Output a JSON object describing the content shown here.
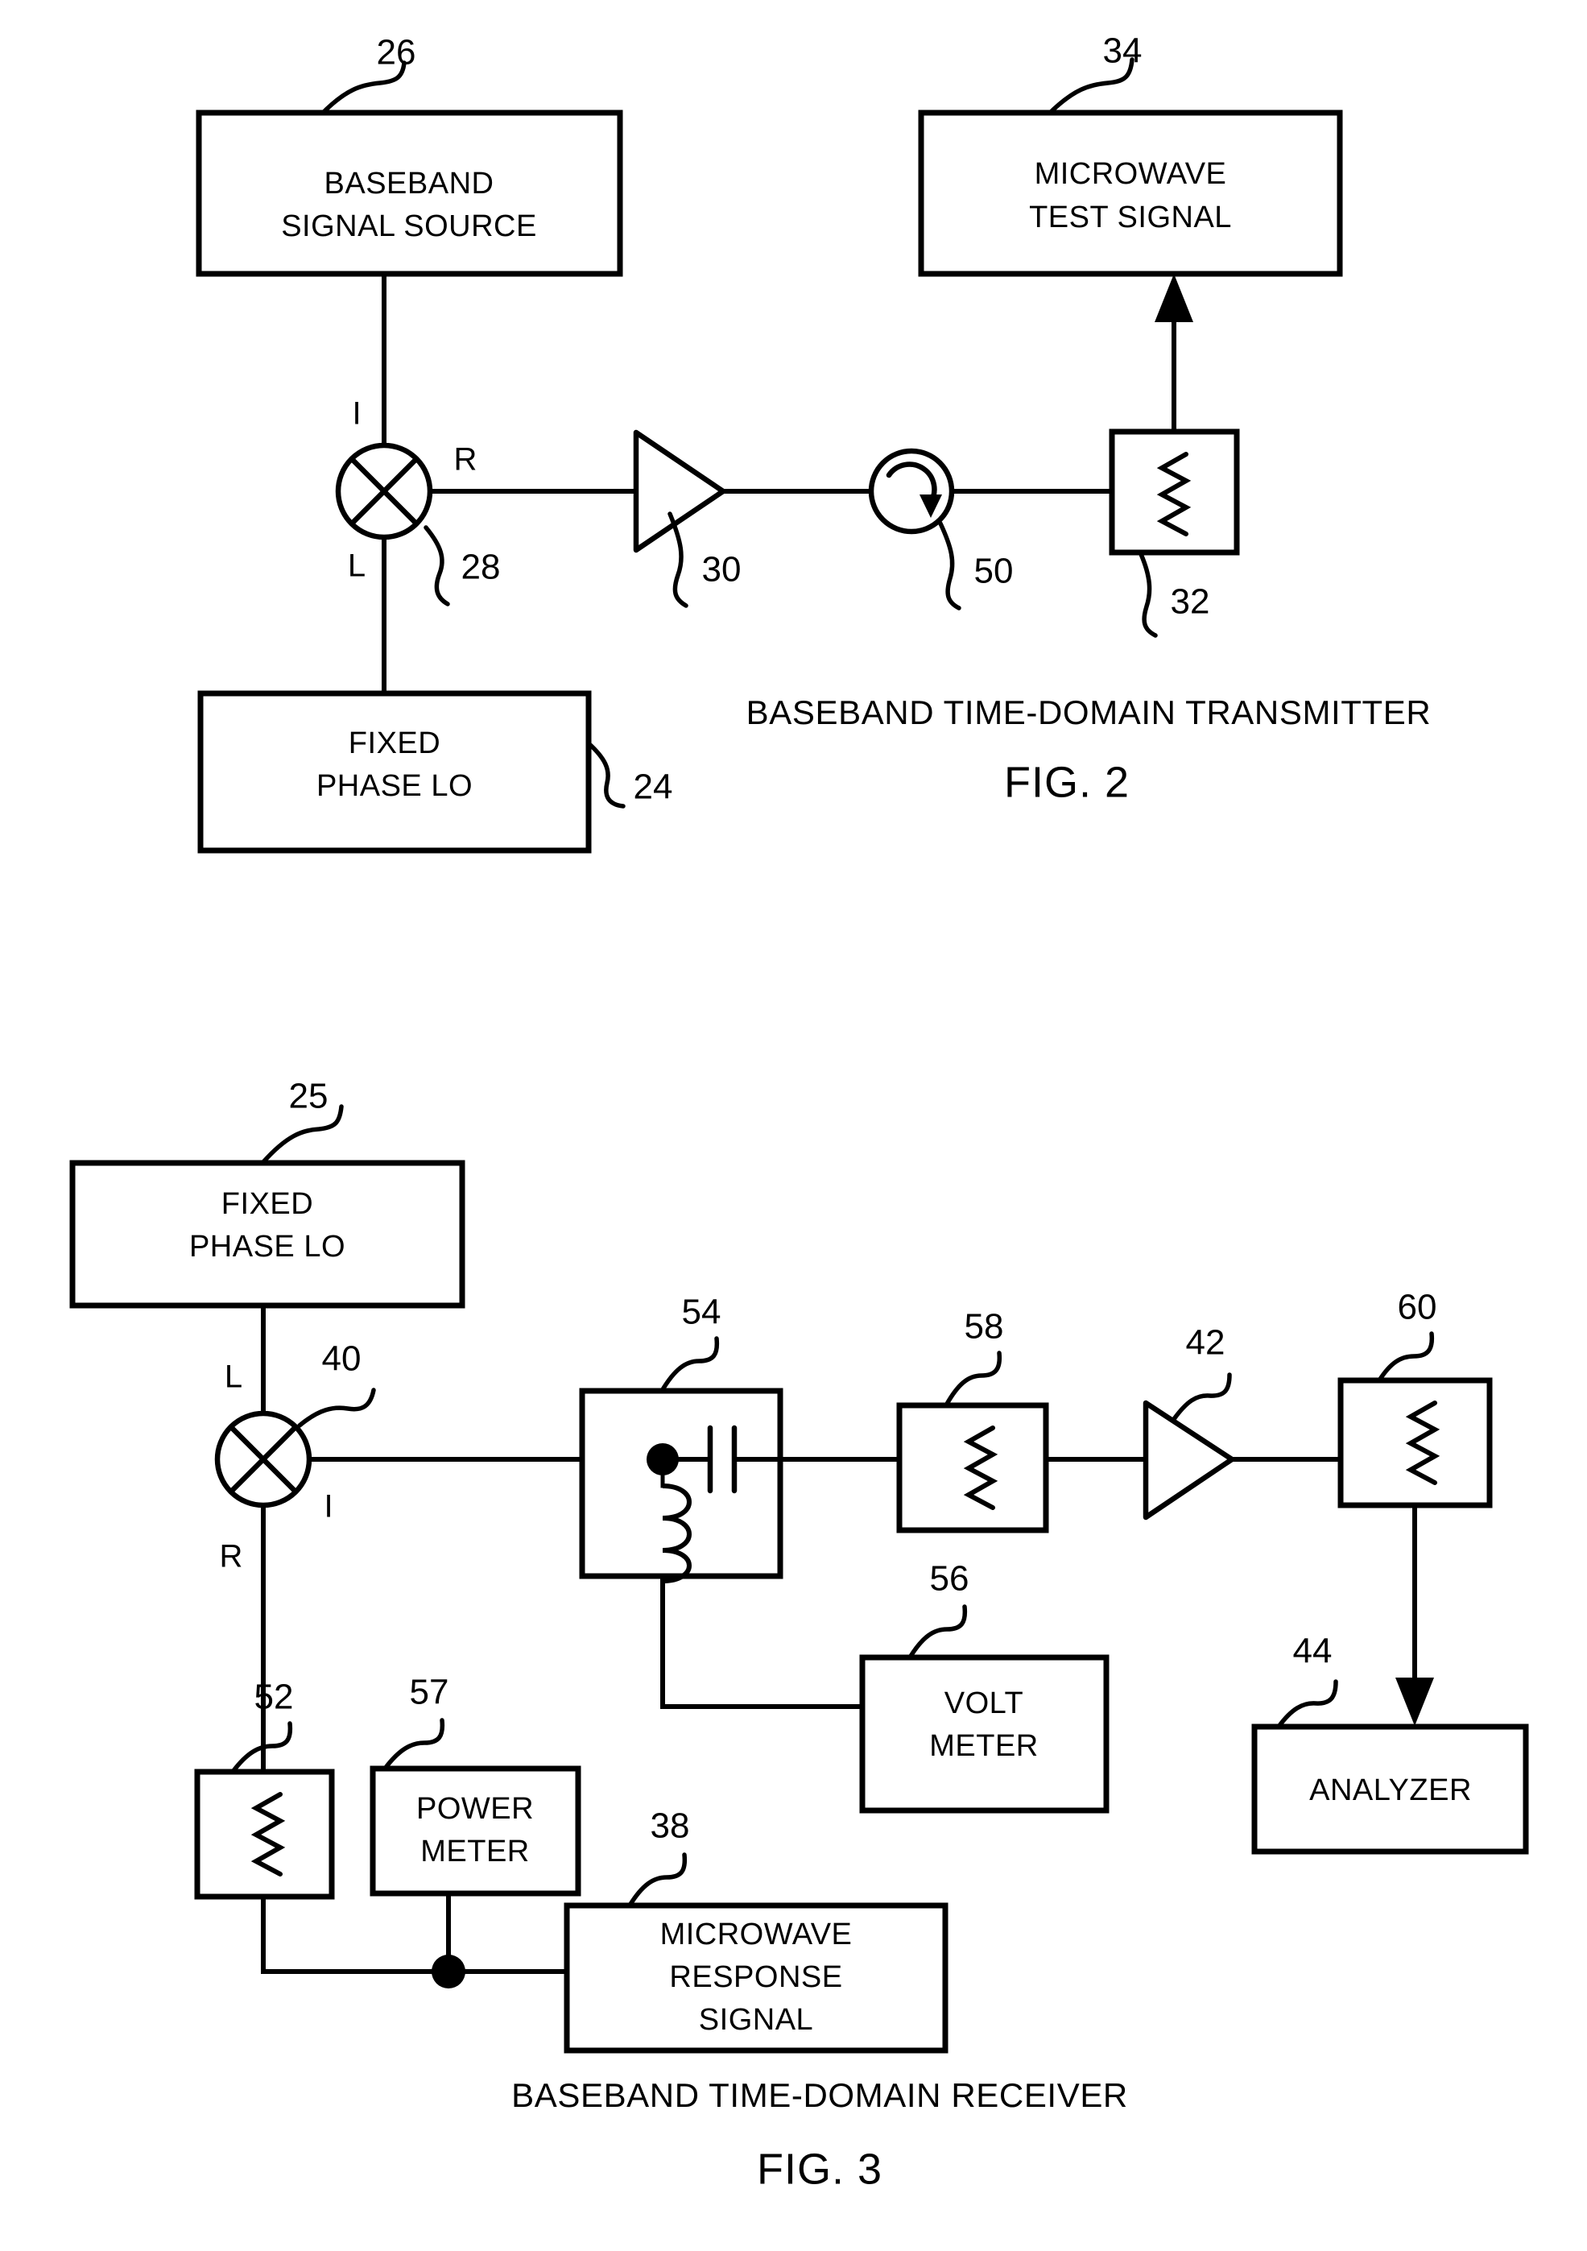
{
  "document": {
    "type": "patent-figure-sheet",
    "figures": [
      {
        "id": "fig2",
        "caption": "BASEBAND TIME-DOMAIN TRANSMITTER",
        "fig_label": "FIG. 2",
        "blocks": [
          {
            "ref": "26",
            "label_line1": "BASEBAND",
            "label_line2": "SIGNAL SOURCE"
          },
          {
            "ref": "34",
            "label_line1": "MICROWAVE",
            "label_line2": "TEST SIGNAL"
          },
          {
            "ref": "24",
            "label_line1": "FIXED",
            "label_line2": "PHASE LO"
          },
          {
            "ref": "32",
            "symbol": "resistor"
          },
          {
            "ref": "28",
            "symbol": "mixer"
          },
          {
            "ref": "30",
            "symbol": "amplifier"
          },
          {
            "ref": "50",
            "symbol": "circulator"
          }
        ],
        "port_labels": {
          "mixer_top": "I",
          "mixer_right": "R",
          "mixer_bottom": "L"
        }
      },
      {
        "id": "fig3",
        "caption": "BASEBAND TIME-DOMAIN RECEIVER",
        "fig_label": "FIG. 3",
        "blocks": [
          {
            "ref": "25",
            "label_line1": "FIXED",
            "label_line2": "PHASE LO"
          },
          {
            "ref": "40",
            "symbol": "mixer"
          },
          {
            "ref": "54",
            "symbol": "lc-network"
          },
          {
            "ref": "58",
            "symbol": "resistor"
          },
          {
            "ref": "42",
            "symbol": "amplifier"
          },
          {
            "ref": "60",
            "symbol": "resistor"
          },
          {
            "ref": "52",
            "symbol": "resistor"
          },
          {
            "ref": "57",
            "label_line1": "POWER",
            "label_line2": "METER"
          },
          {
            "ref": "56",
            "label_line1": "VOLT",
            "label_line2": "METER"
          },
          {
            "ref": "44",
            "label_line1": "ANALYZER"
          },
          {
            "ref": "38",
            "label_line1": "MICROWAVE",
            "label_line2": "RESPONSE",
            "label_line3": "SIGNAL"
          }
        ],
        "port_labels": {
          "mixer_top": "L",
          "mixer_right": "I",
          "mixer_bottom": "R"
        }
      }
    ]
  },
  "fig2": {
    "ref_26": "26",
    "box26_line1": "BASEBAND",
    "box26_line2": "SIGNAL SOURCE",
    "ref_34": "34",
    "box34_line1": "MICROWAVE",
    "box34_line2": "TEST SIGNAL",
    "ref_24": "24",
    "box24_line1": "FIXED",
    "box24_line2": "PHASE LO",
    "ref_28": "28",
    "ref_30": "30",
    "ref_50": "50",
    "ref_32": "32",
    "port_I": "I",
    "port_R": "R",
    "port_L": "L",
    "caption": "BASEBAND TIME-DOMAIN TRANSMITTER",
    "fig_label": "FIG. 2"
  },
  "fig3": {
    "ref_25": "25",
    "box25_line1": "FIXED",
    "box25_line2": "PHASE LO",
    "ref_40": "40",
    "port_L": "L",
    "port_I": "I",
    "port_R": "R",
    "ref_54": "54",
    "ref_58": "58",
    "ref_42": "42",
    "ref_60": "60",
    "ref_52": "52",
    "ref_57": "57",
    "box57_line1": "POWER",
    "box57_line2": "METER",
    "ref_56": "56",
    "box56_line1": "VOLT",
    "box56_line2": "METER",
    "ref_44": "44",
    "box44_line1": "ANALYZER",
    "ref_38": "38",
    "box38_line1": "MICROWAVE",
    "box38_line2": "RESPONSE",
    "box38_line3": "SIGNAL",
    "caption": "BASEBAND TIME-DOMAIN RECEIVER",
    "fig_label": "FIG. 3"
  }
}
